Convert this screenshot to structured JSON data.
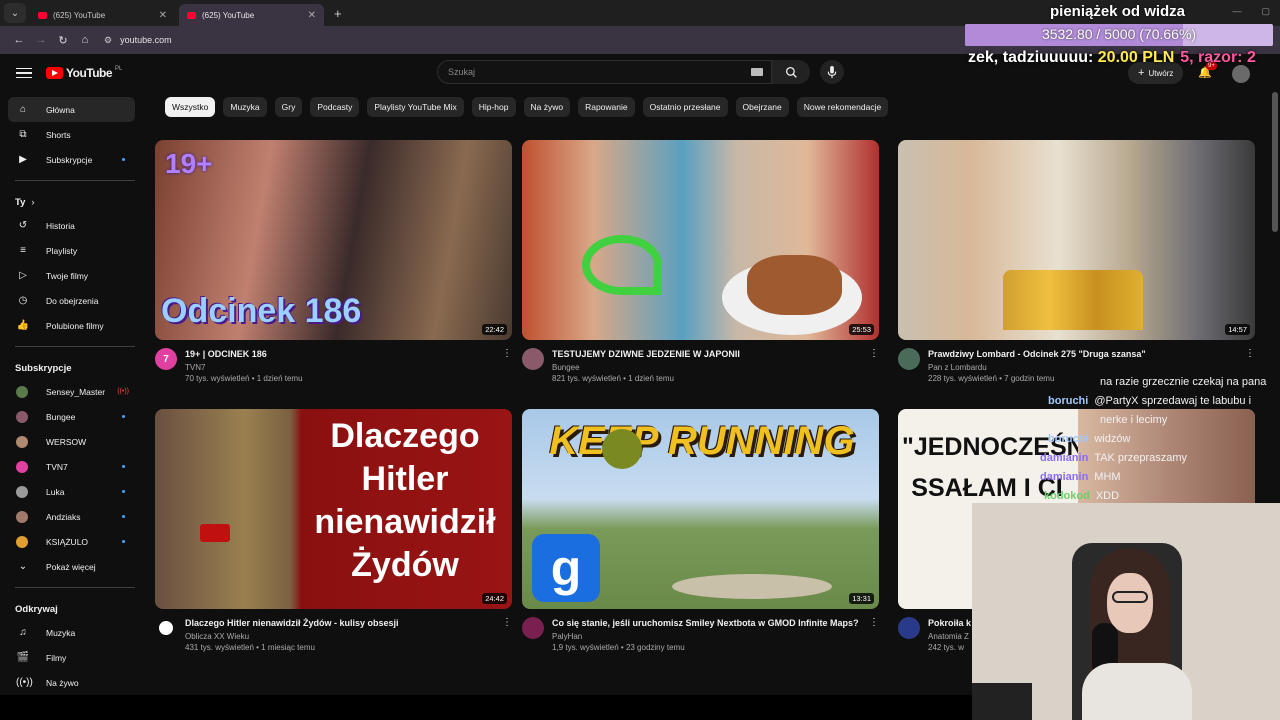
{
  "browser": {
    "tabs": [
      {
        "label": "(625) YouTube",
        "active": false
      },
      {
        "label": "(625) YouTube",
        "active": true
      }
    ],
    "url": "youtube.com"
  },
  "header": {
    "logo": "YouTube",
    "region": "PL",
    "search_placeholder": "Szukaj",
    "create_label": "Utwórz",
    "notifications": "9+"
  },
  "sidebar": {
    "main": [
      {
        "label": "Główna",
        "icon": "home-icon"
      },
      {
        "label": "Shorts",
        "icon": "shorts-icon"
      },
      {
        "label": "Subskrypcje",
        "icon": "subscriptions-icon"
      }
    ],
    "you_heading": "Ty",
    "you": [
      {
        "label": "Historia",
        "icon": "history-icon"
      },
      {
        "label": "Playlisty",
        "icon": "playlists-icon"
      },
      {
        "label": "Twoje filmy",
        "icon": "your-videos-icon"
      },
      {
        "label": "Do obejrzenia",
        "icon": "watch-later-icon"
      },
      {
        "label": "Polubione filmy",
        "icon": "liked-icon"
      }
    ],
    "subs_heading": "Subskrypcje",
    "subs": [
      {
        "label": "Sensey_Master",
        "color": "#5a7a4a"
      },
      {
        "label": "Bungee",
        "color": "#8a5a6a"
      },
      {
        "label": "WERSOW",
        "color": "#b08a70"
      },
      {
        "label": "TVN7",
        "color": "#e040a0"
      },
      {
        "label": "Luka",
        "color": "#9a9a9a"
      },
      {
        "label": "Andziaks",
        "color": "#a07a6a"
      },
      {
        "label": "KSIĄŻULO",
        "color": "#e0a030"
      }
    ],
    "show_more": "Pokaż więcej",
    "explore_heading": "Odkrywaj",
    "explore": [
      {
        "label": "Muzyka",
        "icon": "music-icon"
      },
      {
        "label": "Filmy",
        "icon": "movies-icon"
      },
      {
        "label": "Na żywo",
        "icon": "live-icon"
      }
    ]
  },
  "chips": [
    "Wszystko",
    "Muzyka",
    "Gry",
    "Podcasty",
    "Playlisty YouTube Mix",
    "Hip-hop",
    "Na żywo",
    "Rapowanie",
    "Ostatnio przesłane",
    "Obejrzane",
    "Nowe rekomendacje"
  ],
  "videos": [
    {
      "title": "19+ | ODCINEK 186",
      "channel": "TVN7",
      "stats": "70 tys. wyświetleń • 1 dzień temu",
      "duration": "22:42",
      "thumb_text": "Odcinek 186",
      "badge": "19+",
      "avatar_text": "7",
      "avatar_color": "#e040a0"
    },
    {
      "title": "TESTUJEMY DZIWNE JEDZENIE W JAPONII",
      "channel": "Bungee",
      "stats": "821 tys. wyświetleń • 1 dzień temu",
      "duration": "25:53",
      "avatar_color": "#8a5a6a"
    },
    {
      "title": "Prawdziwy Lombard - Odcinek 275 \"Druga szansa\"",
      "channel": "Pan z Lombardu",
      "stats": "228 tys. wyświetleń • 7 godzin temu",
      "duration": "14:57",
      "avatar_color": "#4a6a5a"
    },
    {
      "title": "Dlaczego Hitler nienawidził Żydów - kulisy obsesji",
      "channel": "Oblicza XX Wieku",
      "stats": "431 tys. wyświetleń • 1 miesiąc temu",
      "duration": "24:42",
      "thumb_text": "Dlaczego Hitler nienawidził Żydów",
      "avatar_color": "#ffffff"
    },
    {
      "title": "Co się stanie, jeśli uruchomisz Smiley Nextbota w GMOD Infinite Maps?",
      "channel": "PalyHan",
      "stats": "1,9 tys. wyświetleń • 23 godziny temu",
      "duration": "13:31",
      "thumb_text": "KEEP RUNNING",
      "avatar_color": "#7a2050"
    },
    {
      "title": "Pokroiła k",
      "channel": "Anatomia Z",
      "stats": "242 tys. w",
      "thumb_text": "\"JEDNOCZEŚNIE SSAŁAM I CI",
      "avatar_color": "#2a3a8a"
    }
  ],
  "overlay": {
    "donation_title": "pieniążek od widza",
    "donation_progress": "3532.80 / 5000 (70.66%)",
    "donation_fraction": 0.7066,
    "marquee_prefix": "zek, tadziuuuuu: ",
    "marquee_amount": "20.00 PLN",
    "marquee_suffix": "5, razor: 2",
    "chat": [
      {
        "user": "",
        "msg": "na razie grzecznie czekaj na pana",
        "color": "#ffffff"
      },
      {
        "user": "boruchi",
        "msg": "@PartyX sprzedawaj te labubu i",
        "color": "#a0c8ff"
      },
      {
        "user": "",
        "msg": "nerke i lecimy",
        "color": "#ffffff"
      },
      {
        "user": "boruchi",
        "msg": "widzów",
        "color": "#a0c8ff"
      },
      {
        "user": "damianin",
        "msg": "TAK przepraszamy",
        "color": "#8a6aff"
      },
      {
        "user": "damianin",
        "msg": "MHM",
        "color": "#8a6aff"
      },
      {
        "user": "kodokod",
        "msg": "XDD",
        "color": "#6ad06a"
      }
    ]
  }
}
